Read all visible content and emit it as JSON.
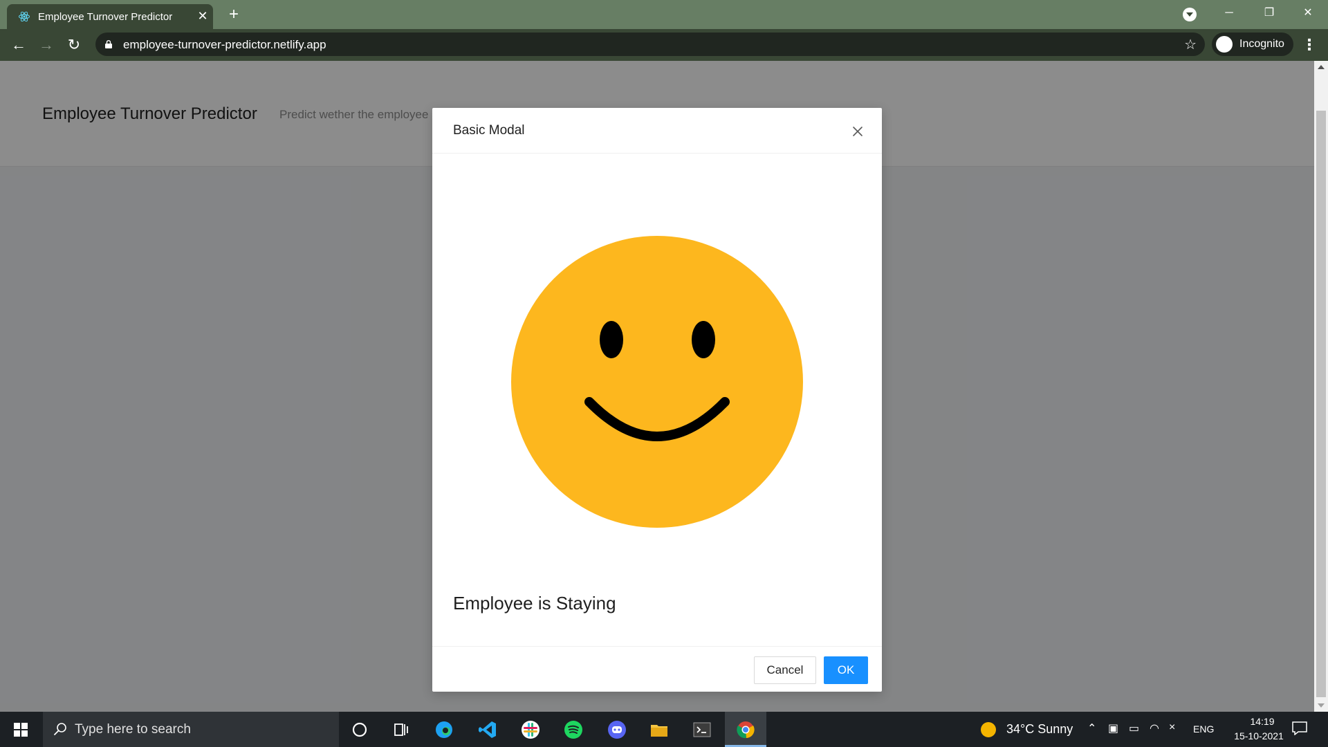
{
  "browser": {
    "tab_title": "Employee Turnover Predictor",
    "url": "employee-turnover-predictor.netlify.app",
    "incognito_label": "Incognito"
  },
  "page": {
    "app_title": "Employee Turnover Predictor",
    "app_subtitle": "Predict wether the employee"
  },
  "modal": {
    "title": "Basic Modal",
    "result_text": "Employee is Staying",
    "cancel_label": "Cancel",
    "ok_label": "OK",
    "image_icon": "smiley-face-icon",
    "smiley_color": "#fdb71e",
    "ok_color": "#1890ff"
  },
  "taskbar": {
    "search_placeholder": "Type here to search",
    "weather": "34°C  Sunny",
    "language": "ENG",
    "time": "14:19",
    "date": "15-10-2021",
    "apps": [
      "cortana-icon",
      "task-view-icon",
      "edge-icon",
      "vscode-icon",
      "slack-icon",
      "spotify-icon",
      "discord-icon",
      "file-explorer-icon",
      "terminal-icon",
      "chrome-icon"
    ]
  }
}
